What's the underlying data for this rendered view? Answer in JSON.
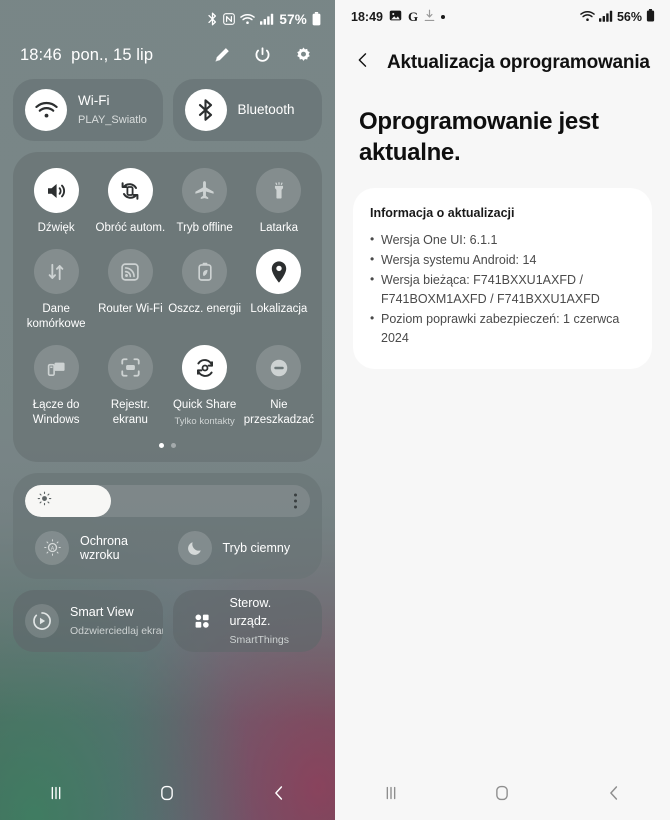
{
  "left_panel": {
    "status_bar": {
      "battery_percent": "57%",
      "icons": [
        "bluetooth-icon",
        "nfc-icon",
        "wifi-icon",
        "signal-icon",
        "battery-icon"
      ]
    },
    "header": {
      "time": "18:46",
      "date": "pon., 15 lip",
      "actions": [
        "edit-icon",
        "power-icon",
        "settings-icon"
      ]
    },
    "connection_pills": [
      {
        "title": "Wi-Fi",
        "subtitle": "PLAY_Swiatlo",
        "icon": "wifi-icon",
        "active": true
      },
      {
        "title": "Bluetooth",
        "subtitle": "",
        "icon": "bluetooth-icon",
        "active": true
      }
    ],
    "toggles": [
      {
        "label": "Dźwięk",
        "sub": "",
        "icon": "sound-icon",
        "active": true
      },
      {
        "label": "Obróć autom.",
        "sub": "",
        "icon": "auto-rotate-icon",
        "active": true
      },
      {
        "label": "Tryb offline",
        "sub": "",
        "icon": "airplane-icon",
        "active": false
      },
      {
        "label": "Latarka",
        "sub": "",
        "icon": "flashlight-icon",
        "active": false
      },
      {
        "label": "Dane komórkowe",
        "sub": "",
        "icon": "mobile-data-icon",
        "active": false
      },
      {
        "label": "Router Wi-Fi",
        "sub": "",
        "icon": "hotspot-icon",
        "active": false
      },
      {
        "label": "Oszcz. energii",
        "sub": "",
        "icon": "power-saving-icon",
        "active": false
      },
      {
        "label": "Lokalizacja",
        "sub": "",
        "icon": "location-pin-icon",
        "active": true
      },
      {
        "label": "Łącze do Windows",
        "sub": "",
        "icon": "link-to-windows-icon",
        "active": false
      },
      {
        "label": "Rejestr. ekranu",
        "sub": "",
        "icon": "screen-recorder-icon",
        "active": false
      },
      {
        "label": "Quick Share",
        "sub": "Tylko kontakty",
        "icon": "quick-share-icon",
        "active": true
      },
      {
        "label": "Nie przeszkadzać",
        "sub": "",
        "icon": "do-not-disturb-icon",
        "active": false
      }
    ],
    "page_indicator": {
      "pages": 2,
      "current": 1
    },
    "brightness": {
      "value_percent": 30,
      "sun_icon": "brightness-icon",
      "menu_icon": "more-options-icon"
    },
    "display_options": [
      {
        "label": "Ochrona wzroku",
        "icon": "eye-comfort-icon"
      },
      {
        "label": "Tryb ciemny",
        "icon": "dark-mode-icon"
      }
    ],
    "media_pills": [
      {
        "title": "Smart View",
        "subtitle": "Odzwierciedlaj ekran",
        "icon": "smart-view-icon"
      },
      {
        "title": "Sterow. urządz.",
        "subtitle": "SmartThings",
        "icon": "device-control-icon"
      }
    ],
    "nav_bar": [
      {
        "name": "recents-button",
        "icon": "recents-icon"
      },
      {
        "name": "home-button",
        "icon": "home-icon"
      },
      {
        "name": "back-button",
        "icon": "back-icon"
      }
    ]
  },
  "right_panel": {
    "status_bar": {
      "time": "18:49",
      "battery_percent": "56%",
      "left_icons": [
        "image-icon",
        "google-icon",
        "download-icon",
        "dot-icon"
      ],
      "right_icons": [
        "wifi-icon",
        "signal-icon",
        "battery-icon"
      ]
    },
    "header": {
      "back_icon": "back-chevron-icon",
      "title": "Aktualizacja oprogramowania"
    },
    "main": {
      "heading": "Oprogramowanie jest aktualne.",
      "card": {
        "title": "Informacja o aktualizacji",
        "items": [
          "Wersja One UI: 6.1.1",
          "Wersja systemu Android: 14",
          "Wersja bieżąca: F741BXXU1AXFD / F741BOXM1AXFD / F741BXXU1AXFD",
          "Poziom poprawki zabezpieczeń: 1 czerwca 2024"
        ]
      }
    },
    "nav_bar": [
      {
        "name": "recents-button",
        "icon": "recents-icon"
      },
      {
        "name": "home-button",
        "icon": "home-icon"
      },
      {
        "name": "back-button",
        "icon": "back-icon"
      }
    ]
  },
  "colors": {
    "panel_overlay": "#788586",
    "right_background": "#f7f7f7",
    "card_white": "#ffffff",
    "accent_white": "#ffffff"
  }
}
